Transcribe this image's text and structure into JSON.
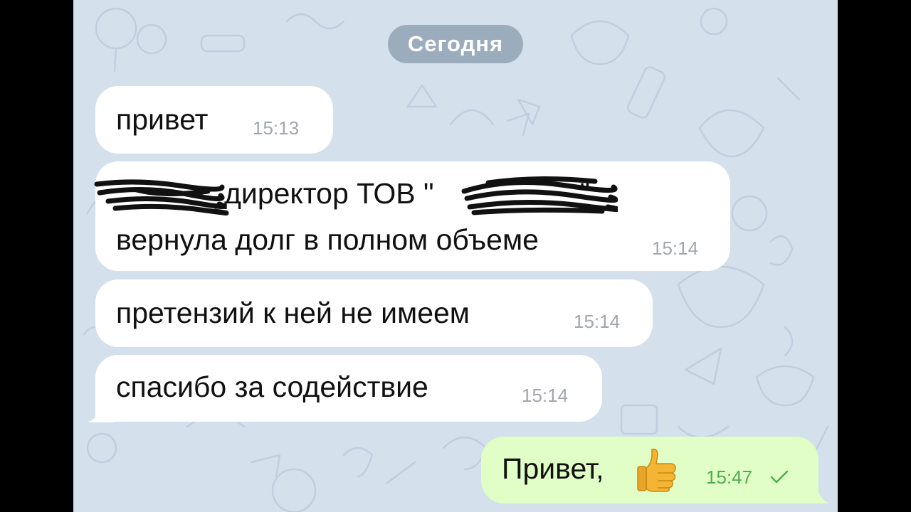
{
  "chat": {
    "date_label": "Сегодня",
    "messages": [
      {
        "text": "привет",
        "time": "15:13"
      },
      {
        "line1": "директор ТОВ \"",
        "line1_end": "\"",
        "line2": "вернула долг в полном объеме",
        "time": "15:14"
      },
      {
        "text": "претензий к ней не имеем",
        "time": "15:14"
      },
      {
        "text": "спасибо за содействие",
        "time": "15:14"
      }
    ],
    "outgoing": {
      "text": "Привет,",
      "emoji": "thumbs-up",
      "time": "15:47",
      "status": "sent-check"
    }
  },
  "colors": {
    "background": "#d4e0ec",
    "incoming_bubble": "#ffffff",
    "outgoing_bubble": "#e1fec6",
    "outgoing_time": "#4fae4e",
    "incoming_time": "#a2a7ad"
  }
}
